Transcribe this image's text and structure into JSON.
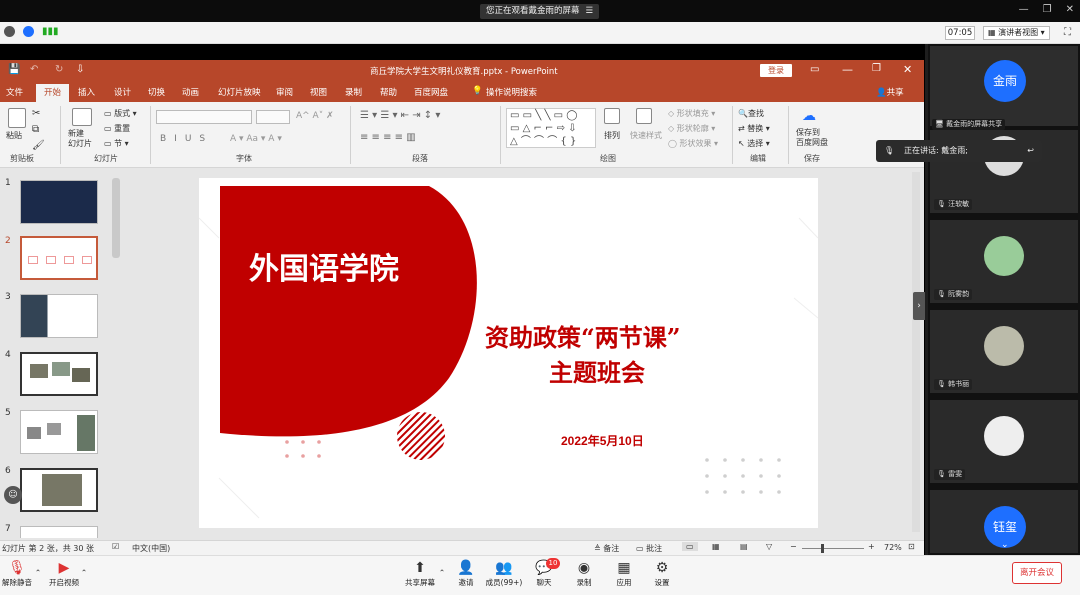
{
  "zoom_meeting": {
    "notice": "您正在观看戴金雨的屏幕",
    "clock": "07:05",
    "view_mode": "演讲者视图",
    "speaking": "正在讲话: 戴金雨;"
  },
  "powerpoint": {
    "title": "商丘学院大学生文明礼仪教育.pptx  -  PowerPoint",
    "login": "登录",
    "tabs": [
      "文件",
      "开始",
      "插入",
      "设计",
      "切换",
      "动画",
      "幻灯片放映",
      "审阅",
      "视图",
      "录制",
      "帮助",
      "百度网盘"
    ],
    "tell_me": "操作说明搜索",
    "share": "共享",
    "groups": {
      "clipboard": "剪贴板",
      "slides": "幻灯片",
      "font": "字体",
      "paragraph": "段落",
      "drawing": "绘图",
      "editing": "编辑",
      "save": "保存"
    },
    "ribbon_labels": {
      "paste": "粘贴",
      "new_slide": "新建\n幻灯片",
      "layout": "版式",
      "reset": "重置",
      "section": "节",
      "arrange": "排列",
      "quick_styles": "快速样式",
      "shape_fill": "形状填充",
      "shape_outline": "形状轮廓",
      "shape_effects": "形状效果",
      "find": "查找",
      "replace": "替换",
      "select": "选择",
      "save_to_baidu": "保存到\n百度网盘"
    },
    "thumb_numbers": [
      "1",
      "2",
      "3",
      "4",
      "5",
      "6",
      "7"
    ],
    "slide": {
      "school": "外国语学院",
      "title_line1": "资助政策“两节课”",
      "title_line2": "主题班会",
      "date": "2022年5月10日"
    },
    "status": {
      "slide_info": "幻灯片 第 2 张，共 30 张",
      "language": "中文(中国)",
      "notes": "备注",
      "comments": "批注",
      "zoom": "72%"
    }
  },
  "gallery": {
    "participants": [
      {
        "name": "金雨",
        "label": "戴金雨的屏幕共享"
      },
      {
        "name": "汪软敏"
      },
      {
        "name": "阮雾韵"
      },
      {
        "name": "韩书丽"
      },
      {
        "name": "雷雯"
      },
      {
        "name": "钰玺"
      }
    ]
  },
  "toolbar": {
    "mute": "解除静音",
    "video": "开启视频",
    "share": "共享屏幕",
    "invite": "邀请",
    "members": "成员(99+)",
    "chat": "聊天",
    "chat_badge": "10",
    "record": "录制",
    "apps": "应用",
    "settings": "设置",
    "leave": "离开会议"
  },
  "colors": {
    "ppt_red": "#b7472a",
    "slide_red": "#c00000",
    "zoom_blue": "#1e6fff"
  }
}
